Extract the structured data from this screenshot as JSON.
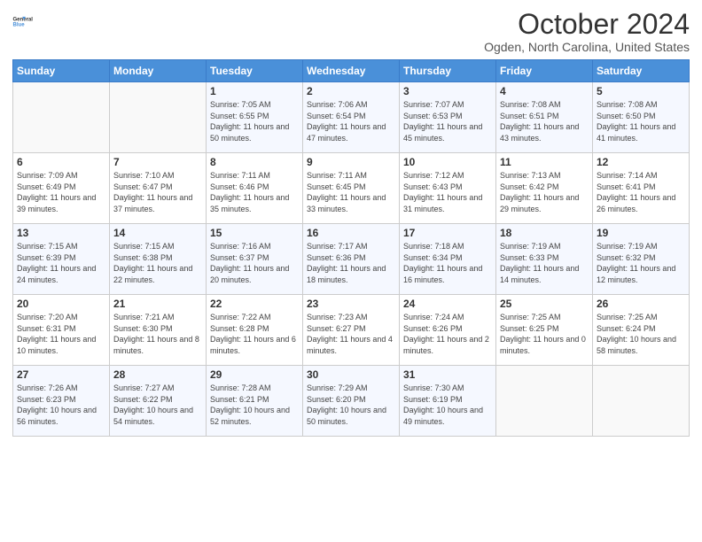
{
  "header": {
    "logo_line1": "General",
    "logo_line2": "Blue",
    "month": "October 2024",
    "location": "Ogden, North Carolina, United States"
  },
  "weekdays": [
    "Sunday",
    "Monday",
    "Tuesday",
    "Wednesday",
    "Thursday",
    "Friday",
    "Saturday"
  ],
  "weeks": [
    [
      {
        "day": "",
        "sunrise": "",
        "sunset": "",
        "daylight": ""
      },
      {
        "day": "",
        "sunrise": "",
        "sunset": "",
        "daylight": ""
      },
      {
        "day": "1",
        "sunrise": "Sunrise: 7:05 AM",
        "sunset": "Sunset: 6:55 PM",
        "daylight": "Daylight: 11 hours and 50 minutes."
      },
      {
        "day": "2",
        "sunrise": "Sunrise: 7:06 AM",
        "sunset": "Sunset: 6:54 PM",
        "daylight": "Daylight: 11 hours and 47 minutes."
      },
      {
        "day": "3",
        "sunrise": "Sunrise: 7:07 AM",
        "sunset": "Sunset: 6:53 PM",
        "daylight": "Daylight: 11 hours and 45 minutes."
      },
      {
        "day": "4",
        "sunrise": "Sunrise: 7:08 AM",
        "sunset": "Sunset: 6:51 PM",
        "daylight": "Daylight: 11 hours and 43 minutes."
      },
      {
        "day": "5",
        "sunrise": "Sunrise: 7:08 AM",
        "sunset": "Sunset: 6:50 PM",
        "daylight": "Daylight: 11 hours and 41 minutes."
      }
    ],
    [
      {
        "day": "6",
        "sunrise": "Sunrise: 7:09 AM",
        "sunset": "Sunset: 6:49 PM",
        "daylight": "Daylight: 11 hours and 39 minutes."
      },
      {
        "day": "7",
        "sunrise": "Sunrise: 7:10 AM",
        "sunset": "Sunset: 6:47 PM",
        "daylight": "Daylight: 11 hours and 37 minutes."
      },
      {
        "day": "8",
        "sunrise": "Sunrise: 7:11 AM",
        "sunset": "Sunset: 6:46 PM",
        "daylight": "Daylight: 11 hours and 35 minutes."
      },
      {
        "day": "9",
        "sunrise": "Sunrise: 7:11 AM",
        "sunset": "Sunset: 6:45 PM",
        "daylight": "Daylight: 11 hours and 33 minutes."
      },
      {
        "day": "10",
        "sunrise": "Sunrise: 7:12 AM",
        "sunset": "Sunset: 6:43 PM",
        "daylight": "Daylight: 11 hours and 31 minutes."
      },
      {
        "day": "11",
        "sunrise": "Sunrise: 7:13 AM",
        "sunset": "Sunset: 6:42 PM",
        "daylight": "Daylight: 11 hours and 29 minutes."
      },
      {
        "day": "12",
        "sunrise": "Sunrise: 7:14 AM",
        "sunset": "Sunset: 6:41 PM",
        "daylight": "Daylight: 11 hours and 26 minutes."
      }
    ],
    [
      {
        "day": "13",
        "sunrise": "Sunrise: 7:15 AM",
        "sunset": "Sunset: 6:39 PM",
        "daylight": "Daylight: 11 hours and 24 minutes."
      },
      {
        "day": "14",
        "sunrise": "Sunrise: 7:15 AM",
        "sunset": "Sunset: 6:38 PM",
        "daylight": "Daylight: 11 hours and 22 minutes."
      },
      {
        "day": "15",
        "sunrise": "Sunrise: 7:16 AM",
        "sunset": "Sunset: 6:37 PM",
        "daylight": "Daylight: 11 hours and 20 minutes."
      },
      {
        "day": "16",
        "sunrise": "Sunrise: 7:17 AM",
        "sunset": "Sunset: 6:36 PM",
        "daylight": "Daylight: 11 hours and 18 minutes."
      },
      {
        "day": "17",
        "sunrise": "Sunrise: 7:18 AM",
        "sunset": "Sunset: 6:34 PM",
        "daylight": "Daylight: 11 hours and 16 minutes."
      },
      {
        "day": "18",
        "sunrise": "Sunrise: 7:19 AM",
        "sunset": "Sunset: 6:33 PM",
        "daylight": "Daylight: 11 hours and 14 minutes."
      },
      {
        "day": "19",
        "sunrise": "Sunrise: 7:19 AM",
        "sunset": "Sunset: 6:32 PM",
        "daylight": "Daylight: 11 hours and 12 minutes."
      }
    ],
    [
      {
        "day": "20",
        "sunrise": "Sunrise: 7:20 AM",
        "sunset": "Sunset: 6:31 PM",
        "daylight": "Daylight: 11 hours and 10 minutes."
      },
      {
        "day": "21",
        "sunrise": "Sunrise: 7:21 AM",
        "sunset": "Sunset: 6:30 PM",
        "daylight": "Daylight: 11 hours and 8 minutes."
      },
      {
        "day": "22",
        "sunrise": "Sunrise: 7:22 AM",
        "sunset": "Sunset: 6:28 PM",
        "daylight": "Daylight: 11 hours and 6 minutes."
      },
      {
        "day": "23",
        "sunrise": "Sunrise: 7:23 AM",
        "sunset": "Sunset: 6:27 PM",
        "daylight": "Daylight: 11 hours and 4 minutes."
      },
      {
        "day": "24",
        "sunrise": "Sunrise: 7:24 AM",
        "sunset": "Sunset: 6:26 PM",
        "daylight": "Daylight: 11 hours and 2 minutes."
      },
      {
        "day": "25",
        "sunrise": "Sunrise: 7:25 AM",
        "sunset": "Sunset: 6:25 PM",
        "daylight": "Daylight: 11 hours and 0 minutes."
      },
      {
        "day": "26",
        "sunrise": "Sunrise: 7:25 AM",
        "sunset": "Sunset: 6:24 PM",
        "daylight": "Daylight: 10 hours and 58 minutes."
      }
    ],
    [
      {
        "day": "27",
        "sunrise": "Sunrise: 7:26 AM",
        "sunset": "Sunset: 6:23 PM",
        "daylight": "Daylight: 10 hours and 56 minutes."
      },
      {
        "day": "28",
        "sunrise": "Sunrise: 7:27 AM",
        "sunset": "Sunset: 6:22 PM",
        "daylight": "Daylight: 10 hours and 54 minutes."
      },
      {
        "day": "29",
        "sunrise": "Sunrise: 7:28 AM",
        "sunset": "Sunset: 6:21 PM",
        "daylight": "Daylight: 10 hours and 52 minutes."
      },
      {
        "day": "30",
        "sunrise": "Sunrise: 7:29 AM",
        "sunset": "Sunset: 6:20 PM",
        "daylight": "Daylight: 10 hours and 50 minutes."
      },
      {
        "day": "31",
        "sunrise": "Sunrise: 7:30 AM",
        "sunset": "Sunset: 6:19 PM",
        "daylight": "Daylight: 10 hours and 49 minutes."
      },
      {
        "day": "",
        "sunrise": "",
        "sunset": "",
        "daylight": ""
      },
      {
        "day": "",
        "sunrise": "",
        "sunset": "",
        "daylight": ""
      }
    ]
  ]
}
